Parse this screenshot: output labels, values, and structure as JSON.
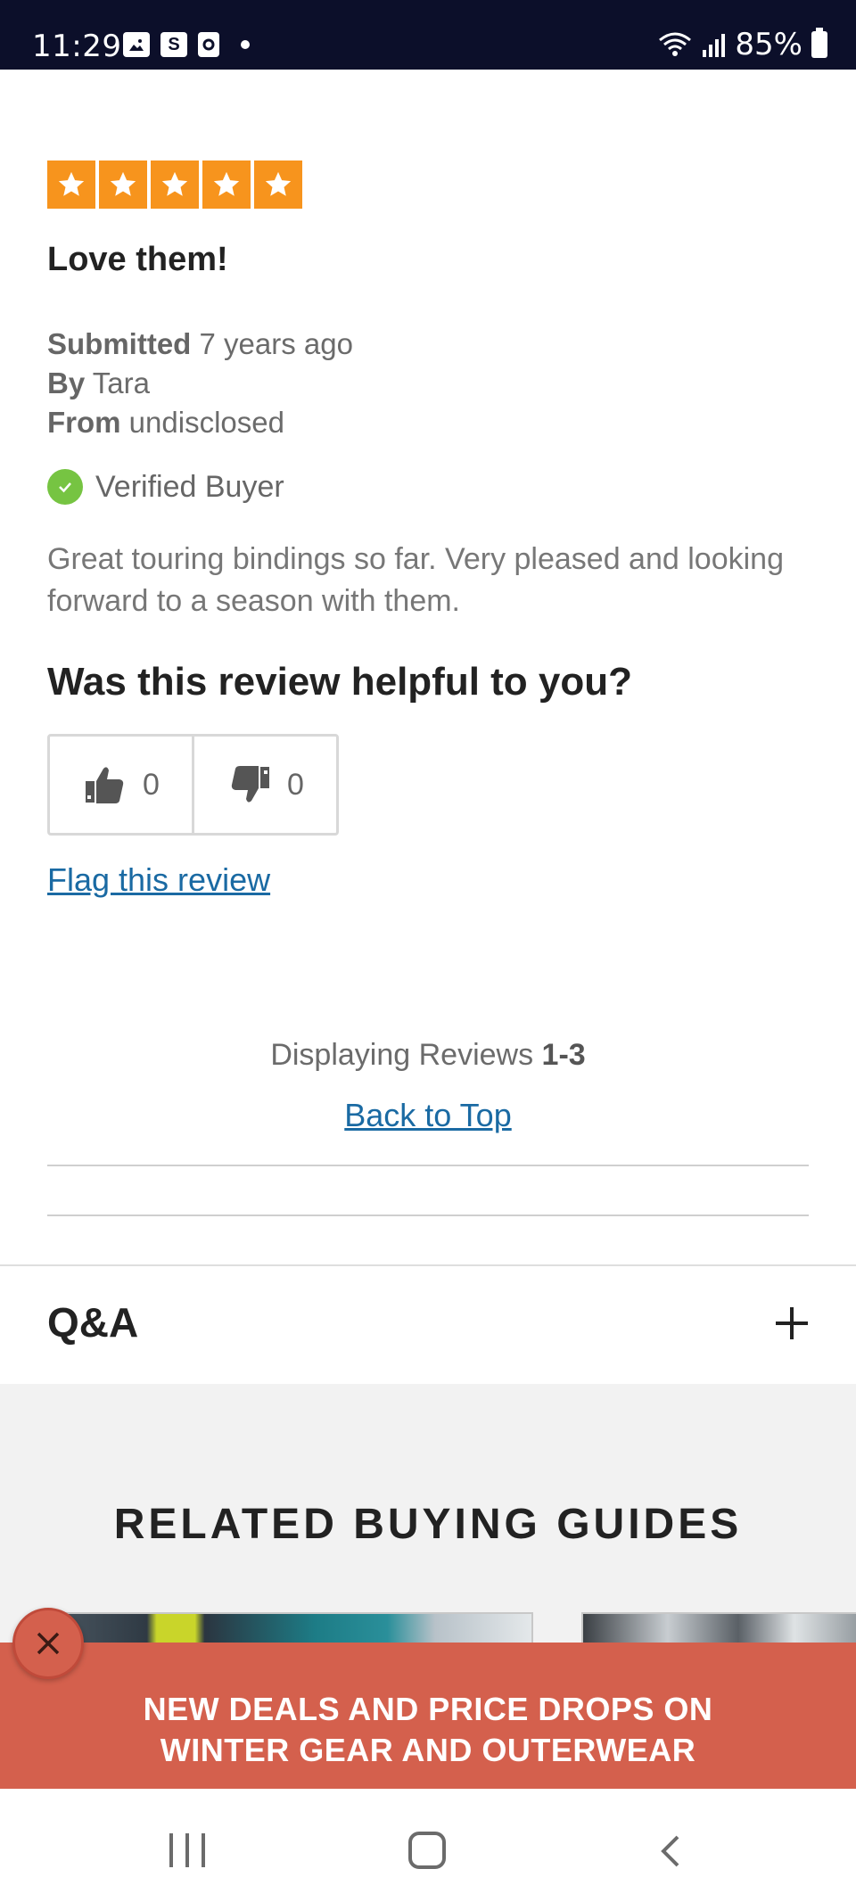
{
  "status_bar": {
    "time": "11:29",
    "battery": "85%",
    "icons": [
      "gallery-icon",
      "s-app-icon",
      "notification-icon",
      "wifi-icon",
      "signal-icon",
      "battery-icon"
    ],
    "s_icon_label": "S"
  },
  "review": {
    "rating": 5,
    "rating_max": 5,
    "star_color": "#f7941d",
    "title": "Love them!",
    "submitted_label": "Submitted",
    "submitted_value": "7 years ago",
    "by_label": "By",
    "by_value": "Tara",
    "from_label": "From",
    "from_value": "undisclosed",
    "verified_label": "Verified Buyer",
    "body": "Great touring bindings so far. Very pleased and looking forward to a season with them.",
    "helpful_question": "Was this review helpful to you?",
    "upvotes": "0",
    "downvotes": "0",
    "flag_link": "Flag this review"
  },
  "pagination": {
    "displaying_label": "Displaying Reviews",
    "range": "1-3",
    "back_to_top": "Back to Top"
  },
  "qa": {
    "label": "Q&A"
  },
  "related": {
    "title": "RELATED BUYING GUIDES"
  },
  "promo": {
    "line1": "NEW DEALS AND PRICE DROPS ON",
    "line2": "WINTER GEAR AND OUTERWEAR",
    "bg_color": "#d4604d"
  },
  "colors": {
    "link": "#1a6aa3",
    "verified": "#76c442",
    "status_bar": "#0c0f2a"
  }
}
